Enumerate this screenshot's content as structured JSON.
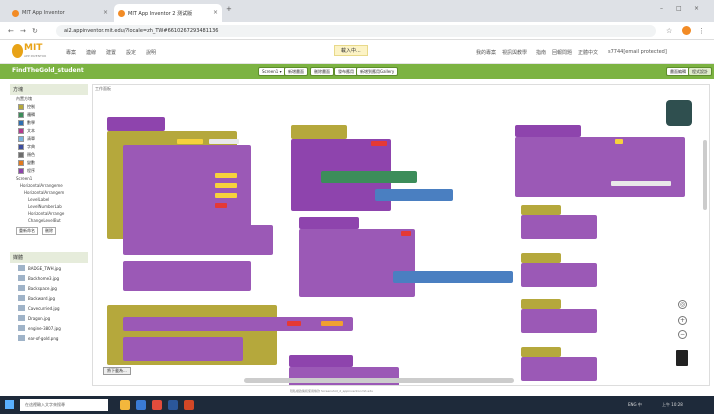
{
  "browser": {
    "tabs": [
      {
        "label": "MIT App Inventor"
      },
      {
        "label": "MIT App Inventor 2 测试版"
      }
    ],
    "url": "ai2.appinventor.mit.edu/?locale=zh_TW#6610267293481136"
  },
  "header": {
    "logo_title": "MIT",
    "logo_subtitle": "APP INVENTOR",
    "menus": [
      "專案",
      "連線",
      "建置",
      "設定",
      "說明"
    ],
    "notice": "載入中...",
    "right_menus": [
      "我的專案",
      "視訊與教學",
      "指南",
      "回報問題",
      "正體中文",
      "s7744[email protected]"
    ]
  },
  "toolbar": {
    "project_name": "FindTheGold_student",
    "buttons": [
      "Screen1 ▾",
      "新增畫面",
      "刪除畫面",
      "發布應用",
      "新增到應用Gallery"
    ],
    "designer": "畫面編輯",
    "blocks": "程式設計"
  },
  "left_panel": {
    "blocks_heading": "方塊",
    "builtin_label": "內置方塊",
    "builtin": [
      {
        "name": "控制",
        "color": "#b5a83c"
      },
      {
        "name": "邏輯",
        "color": "#3c8d5a"
      },
      {
        "name": "數學",
        "color": "#2f6fb0"
      },
      {
        "name": "文本",
        "color": "#b5398d"
      },
      {
        "name": "清單",
        "color": "#7ab3de"
      },
      {
        "name": "字典",
        "color": "#3d4d9e"
      },
      {
        "name": "顏色",
        "color": "#6d6d6d"
      },
      {
        "name": "變數",
        "color": "#e07a1f"
      },
      {
        "name": "程序",
        "color": "#8e44ad"
      }
    ],
    "tree": [
      "Screen1",
      "HorizontalArrangeme",
      "HorizontalArrangem",
      "LevelLabel",
      "LevelNumberLab",
      "HorizontalArrange",
      "ChangeLevelBut"
    ],
    "tree_buttons": [
      "重新命名",
      "刪除"
    ],
    "media_heading": "媒體",
    "media": [
      "BADGE_TWH.jpg",
      "Backhome3.jpg",
      "Backspace.jpg",
      "Backward.jpg",
      "Cavecurried.jpg",
      "Dragon.jpg",
      "engine-3807.jpg",
      "ear-of-gold.png"
    ]
  },
  "workspace": {
    "header": "工作面板",
    "download_label": "將下載為...",
    "footer": "隱私權政策和使用條款    Screenshot_2_appinventor.mit.edu"
  },
  "taskbar": {
    "search_placeholder": "在這裡輸入文字來搜尋",
    "time": "上午 10:28",
    "tray": "ENG  中"
  }
}
